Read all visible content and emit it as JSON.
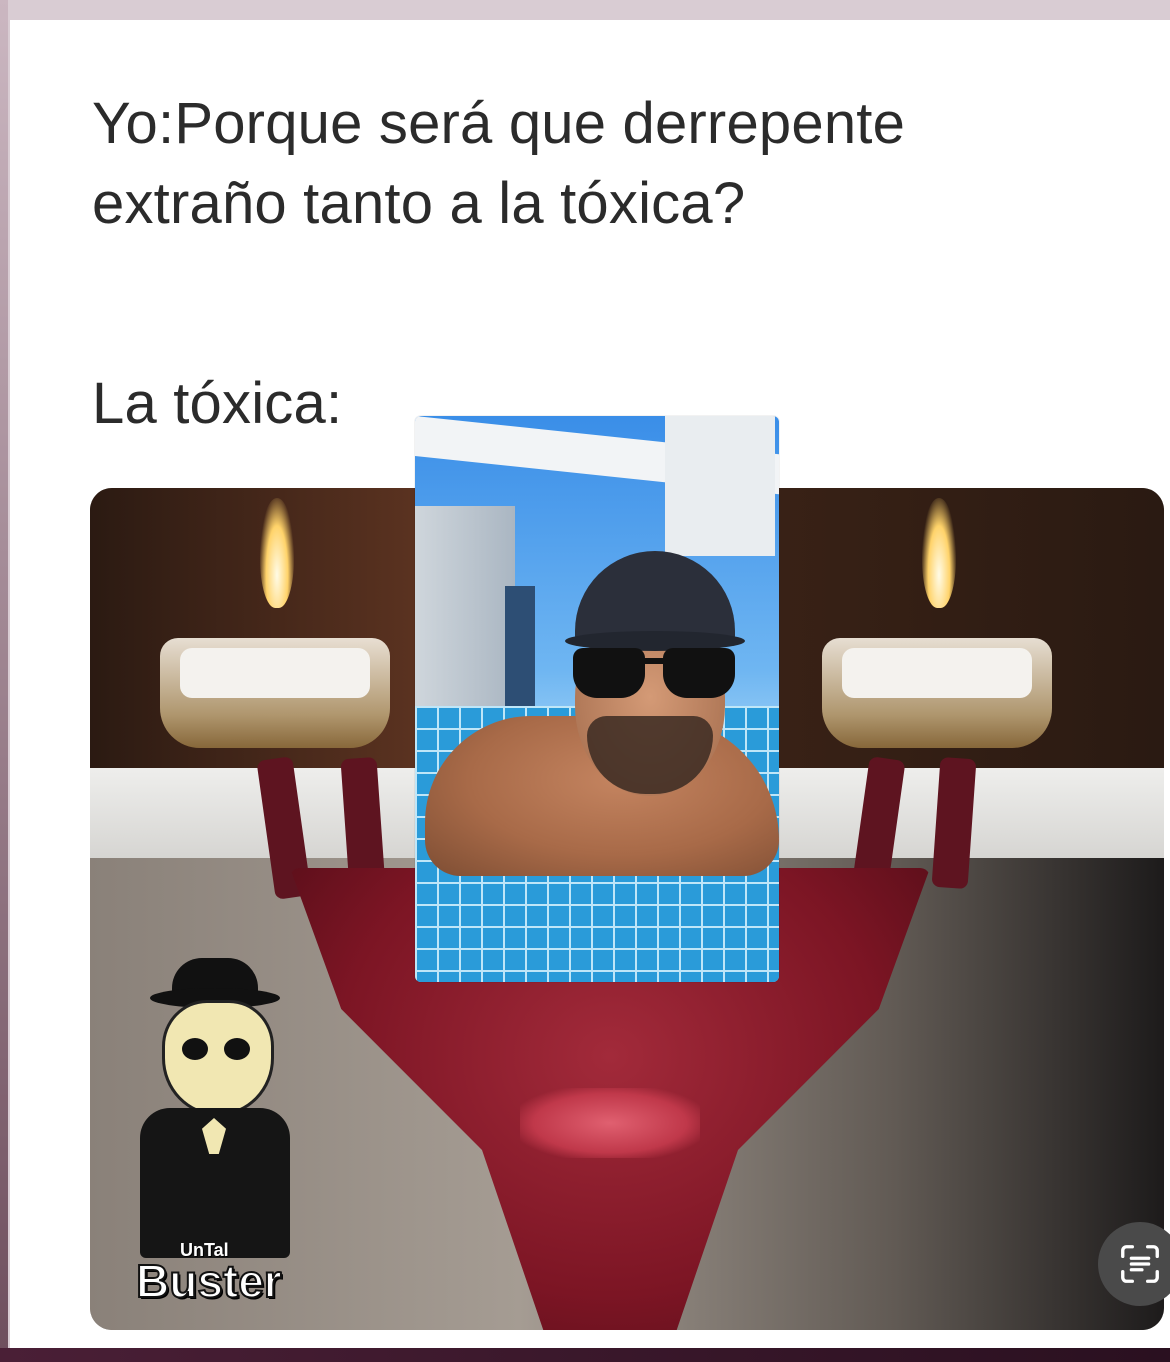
{
  "meme": {
    "line1": "Yo:Porque será que derrepente",
    "line2": "extraño tanto a la tóxica?",
    "line3": "La tóxica:"
  },
  "watermark": {
    "small": "UnTal",
    "big": "Buster"
  },
  "icons": {
    "scan": "live-text-scan-icon"
  }
}
